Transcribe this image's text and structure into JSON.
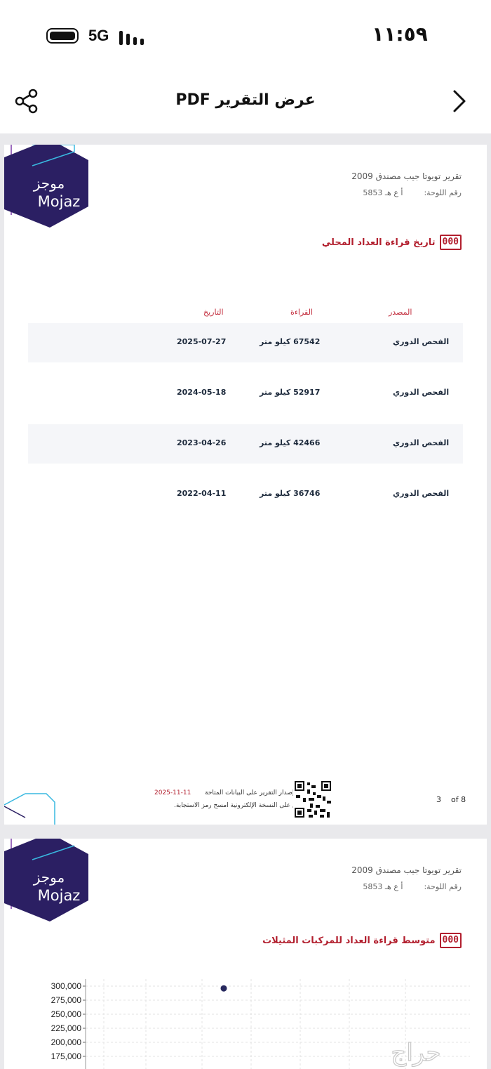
{
  "status_bar": {
    "network": "5G",
    "time": "١١:٥٩"
  },
  "header": {
    "title": "عرض التقرير PDF",
    "share_icon": "share-icon",
    "back_icon": "chevron-right-icon"
  },
  "logo": {
    "arabic": "موجز",
    "english": "Mojaz"
  },
  "report": {
    "title": "تقرير تويوتا جيب مصندق 2009",
    "plate_label": "رقم اللوحة:",
    "plate_value": "أ ع هـ 5853"
  },
  "page1": {
    "section_title": "تاريخ قراءة العداد المحلي",
    "odometer_icon": "000",
    "table": {
      "headers": {
        "source": "المصدر",
        "reading": "القراءة",
        "date": "التاريخ"
      },
      "rows": [
        {
          "source": "الفحص الدوري",
          "reading": "67542 كيلو متر",
          "date": "2025-07-27"
        },
        {
          "source": "الفحص الدوري",
          "reading": "52917 كيلو متر",
          "date": "2024-05-18"
        },
        {
          "source": "الفحص الدوري",
          "reading": "42466 كيلو متر",
          "date": "2023-04-26"
        },
        {
          "source": "الفحص الدوري",
          "reading": "36746 كيلو متر",
          "date": "2022-04-11"
        }
      ]
    },
    "footer": {
      "issued_text": "تم إصدار التقرير على البيانات المتاحة",
      "issued_date": "2025-11-11",
      "scan_text": "للاطلاع على النسخة الإلكترونية امسح رمز الاستجابة.",
      "page": "3",
      "of_label": "of 8"
    }
  },
  "page2": {
    "section_title": "متوسط قراءة العداد للمركبات المثيلات",
    "odometer_icon": "000"
  },
  "chart_data": {
    "type": "scatter",
    "title": "متوسط قراءة العداد للمركبات المثيلات",
    "y_ticks": [
      "300,000",
      "275,000",
      "250,000",
      "225,000",
      "200,000",
      "175,000"
    ],
    "points": [
      {
        "y": 296000
      }
    ]
  },
  "watermark": {
    "text": "حراج"
  }
}
